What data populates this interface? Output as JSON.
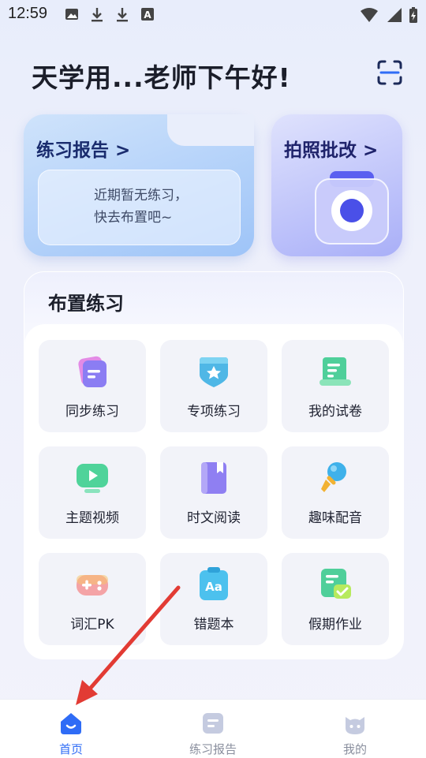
{
  "status_bar": {
    "time": "12:59",
    "icons_left": [
      "image-icon",
      "download-icon",
      "download-icon",
      "text-a-icon"
    ],
    "icons_right": [
      "wifi-icon",
      "signal-icon",
      "battery-charging-icon"
    ]
  },
  "header": {
    "greeting": "天学用...老师下午好!",
    "scan_icon": "scan-icon"
  },
  "report_card": {
    "title": "练习报告 >",
    "empty_text": "近期暂无练习，\n快去布置吧~"
  },
  "photo_card": {
    "title": "拍照批改 >",
    "icon": "camera-icon"
  },
  "assign": {
    "title": "布置练习",
    "tiles": [
      {
        "label": "同步练习",
        "icon": "sync-practice-icon"
      },
      {
        "label": "专项练习",
        "icon": "special-practice-icon"
      },
      {
        "label": "我的试卷",
        "icon": "my-papers-icon"
      },
      {
        "label": "主题视频",
        "icon": "theme-video-icon"
      },
      {
        "label": "时文阅读",
        "icon": "reading-icon"
      },
      {
        "label": "趣味配音",
        "icon": "dubbing-icon"
      },
      {
        "label": "词汇PK",
        "icon": "vocab-pk-icon"
      },
      {
        "label": "错题本",
        "icon": "mistake-book-icon"
      },
      {
        "label": "假期作业",
        "icon": "holiday-homework-icon"
      }
    ]
  },
  "bottom_nav": {
    "items": [
      {
        "label": "首页",
        "icon": "home-icon",
        "active": true
      },
      {
        "label": "练习报告",
        "icon": "report-icon",
        "active": false
      },
      {
        "label": "我的",
        "icon": "profile-icon",
        "active": false
      }
    ],
    "active_color": "#2f6cf6",
    "inactive_color": "#8a8f9e"
  }
}
